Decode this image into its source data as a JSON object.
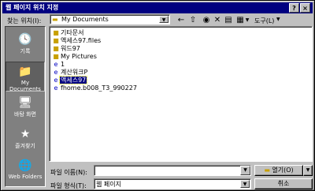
{
  "window": {
    "title": "웹 페이지 위치 지정",
    "help_label": "?",
    "close_label": "×"
  },
  "toolbar": {
    "lookin_label": "찾는 위치(I):",
    "lookin_value": "My Documents",
    "tools_label": "도구(L)"
  },
  "places": [
    {
      "label": "기록",
      "icon": "history-icon"
    },
    {
      "label": "My Documents",
      "icon": "documents-icon"
    },
    {
      "label": "바탕 화면",
      "icon": "desktop-icon"
    },
    {
      "label": "즐겨찾기",
      "icon": "favorites-icon"
    },
    {
      "label": "Web Folders",
      "icon": "web-folders-icon"
    }
  ],
  "files": [
    {
      "name": "기타문서",
      "type": "folder"
    },
    {
      "name": "액세스97.files",
      "type": "folder"
    },
    {
      "name": "워드97",
      "type": "folder"
    },
    {
      "name": "My Pictures",
      "type": "folder"
    },
    {
      "name": "1",
      "type": "web"
    },
    {
      "name": "계산워크P",
      "type": "web"
    },
    {
      "name": "액세스97",
      "type": "web",
      "selected": true
    },
    {
      "name": "fhome.b008_T3_990227",
      "type": "web"
    }
  ],
  "form": {
    "filename_label": "파일 이름(N):",
    "filename_value": "",
    "filetype_label": "파일 형식(T):",
    "filetype_value": "웹 페이지",
    "open_label": "열기(O)",
    "cancel_label": "취소"
  },
  "colors": {
    "titlebar": "#000080",
    "dialog_face": "#c0c0c0",
    "selection": "#000080"
  }
}
